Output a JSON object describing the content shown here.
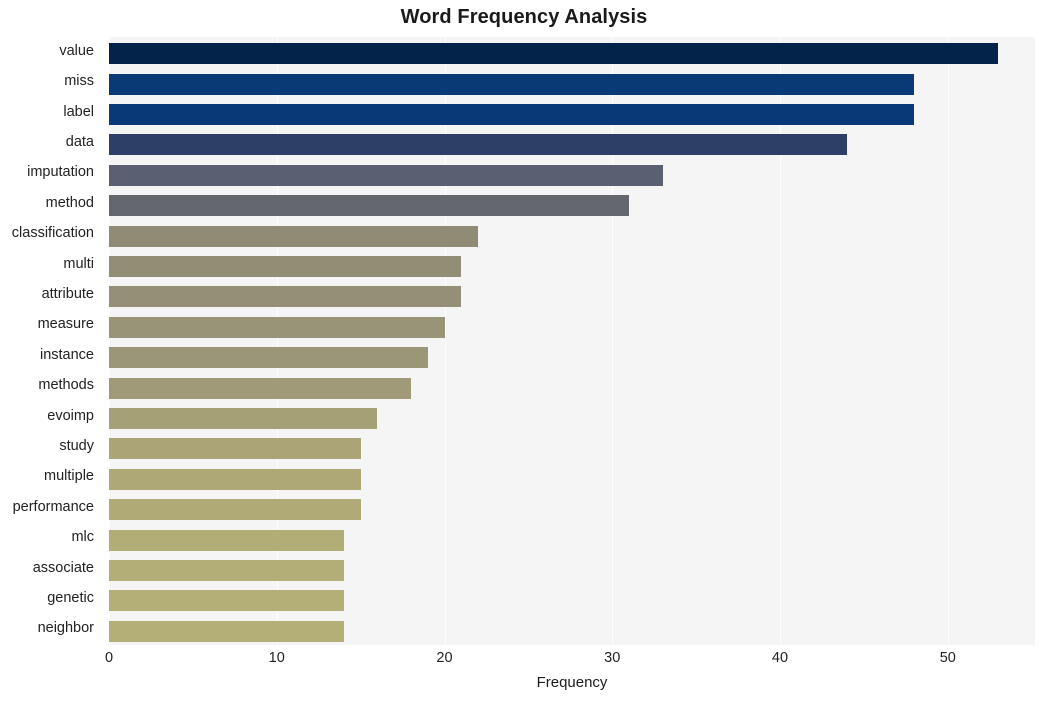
{
  "chart_data": {
    "type": "bar",
    "orientation": "horizontal",
    "title": "Word Frequency Analysis",
    "xlabel": "Frequency",
    "ylabel": "",
    "xlim": [
      0,
      55.2
    ],
    "xticks": [
      0,
      10,
      20,
      30,
      40,
      50
    ],
    "xtick_labels": [
      "0",
      "10",
      "20",
      "30",
      "40",
      "50"
    ],
    "grid": true,
    "grid_axis": "x",
    "legend": "none",
    "plot_background": "#f5f5f6",
    "figure_background": "#ffffff",
    "categories": [
      "value",
      "miss",
      "label",
      "data",
      "imputation",
      "method",
      "classification",
      "multi",
      "attribute",
      "measure",
      "instance",
      "methods",
      "evoimp",
      "study",
      "multiple",
      "performance",
      "mlc",
      "associate",
      "genetic",
      "neighbor"
    ],
    "values": [
      53,
      48,
      48,
      44,
      33,
      31,
      22,
      21,
      21,
      20,
      19,
      18,
      16,
      15,
      15,
      15,
      14,
      14,
      14,
      14
    ],
    "bar_colors": [
      "#04234a",
      "#093a76",
      "#093a77",
      "#2e3f67",
      "#5a6071",
      "#65676f",
      "#908b74",
      "#928d75",
      "#948f76",
      "#999378",
      "#9c9678",
      "#a09a78",
      "#a6a077",
      "#aba477",
      "#aea877",
      "#b0aa77",
      "#b2ac77",
      "#b3ad77",
      "#b4ae77",
      "#b4ae77"
    ]
  }
}
